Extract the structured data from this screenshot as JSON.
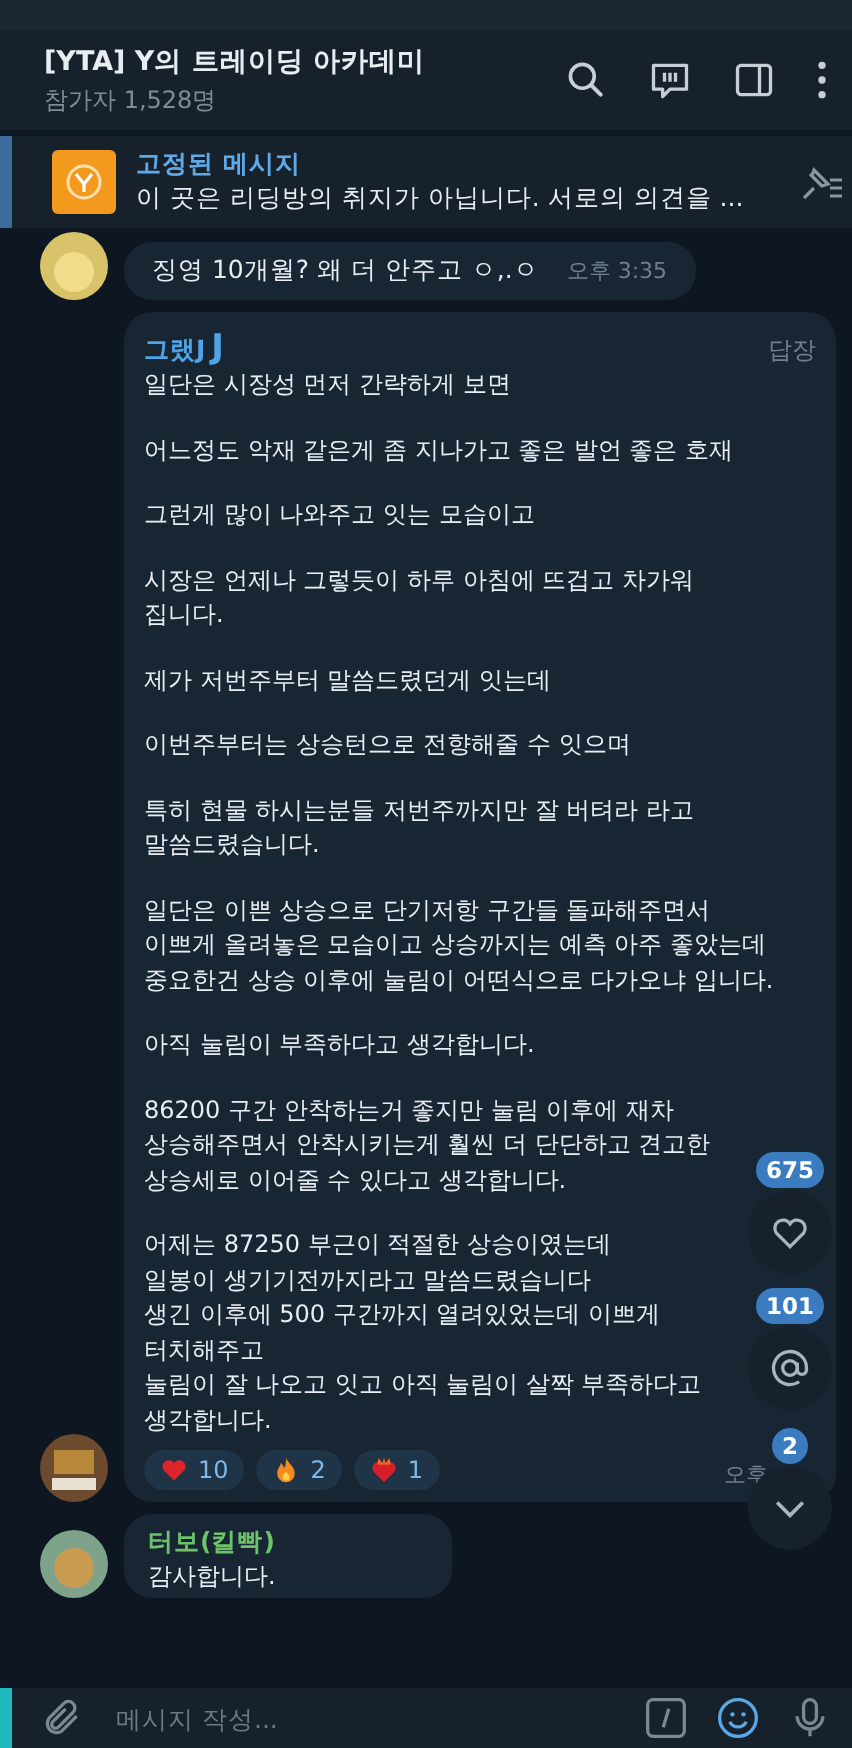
{
  "header": {
    "title": "[YTA] Y의 트레이딩 아카데미",
    "subtitle": "참가자 1,528명"
  },
  "pinned": {
    "label": "고정된 메시지",
    "text": "이 곳은 리딩방의 취지가 아닙니다.  서로의 의견을 ..."
  },
  "messages": [
    {
      "kind": "short",
      "text": "징영 10개월? 왜 더 안주고 ㅇ,.ㅇ",
      "time": "오후 3:35"
    },
    {
      "kind": "long",
      "sender": "그랬J",
      "sender_badge": "J",
      "color": "#4ea4e6",
      "reply": "답장",
      "paragraphs": [
        "일단은 시장성 먼저 간략하게 보면",
        "어느정도 악재 같은게 좀 지나가고 좋은 발언 좋은 호재",
        "그런게 많이 나와주고 잇는 모습이고",
        "시장은 언제나 그렇듯이 하루 아침에 뜨겁고 차가워\n집니다.",
        "제가 저번주부터 말씀드렸던게 잇는데",
        "이번주부터는 상승턴으로 전향해줄 수 잇으며",
        "특히 현물 하시는분들 저번주까지만 잘 버텨라 라고\n말씀드렸습니다.",
        "일단은 이쁜 상승으로 단기저항 구간들 돌파해주면서\n이쁘게 올려놓은 모습이고 상승까지는 예측 아주 좋았는데\n중요한건 상승 이후에 눌림이 어떤식으로 다가오냐 입니다.",
        "아직 눌림이 부족하다고 생각합니다.",
        "86200 구간 안착하는거 좋지만 눌림 이후에 재차\n상승해주면서 안착시키는게 훨씬 더 단단하고 견고한\n상승세로 이어줄 수 있다고 생각합니다.",
        "어제는 87250 부근이 적절한 상승이였는데\n일봉이 생기기전까지라고 말씀드렸습니다\n생긴 이후에 500 구간까지 열려있었는데 이쁘게\n터치해주고\n눌림이 잘 나오고 잇고 아직 눌림이 살짝 부족하다고\n생각합니다."
      ],
      "reactions": [
        {
          "kind": "heart",
          "count": "10"
        },
        {
          "kind": "fire",
          "count": "2"
        },
        {
          "kind": "heart-fire",
          "count": "1"
        }
      ],
      "time": "오후"
    },
    {
      "kind": "named",
      "sender": "터보(킬빡)",
      "color": "#6cc26a",
      "text": "감사합니다."
    }
  ],
  "floating": [
    {
      "kind": "heart",
      "count": "675"
    },
    {
      "kind": "mention",
      "count": "101"
    },
    {
      "kind": "down",
      "count": "2"
    }
  ],
  "composer": {
    "placeholder": "메시지 작성..."
  }
}
